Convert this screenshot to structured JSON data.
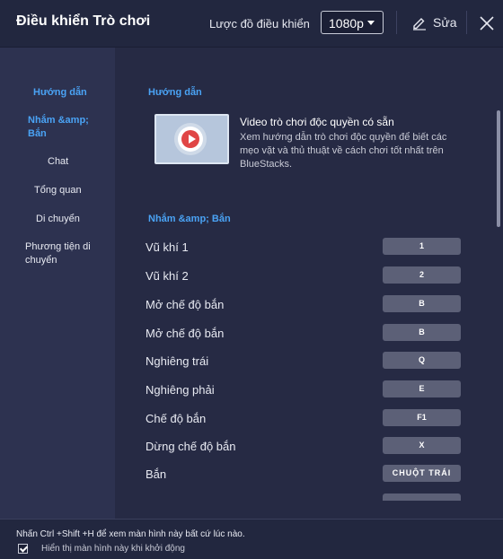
{
  "header": {
    "title": "Điều khiển Trò chơi",
    "scheme_label": "Lược đồ điều khiển",
    "resolution": "1080p",
    "edit_label": "Sửa"
  },
  "sidebar": {
    "items": [
      {
        "label": "Hướng dẫn",
        "active": true
      },
      {
        "label": "Nhắm &amp; Bắn",
        "active": true
      },
      {
        "label": "Chat",
        "active": false
      },
      {
        "label": "Tổng quan",
        "active": false
      },
      {
        "label": "Di chuyển",
        "active": false
      },
      {
        "label": "Phương tiện di chuyển",
        "active": false
      }
    ]
  },
  "guide": {
    "section_title": "Hướng dẫn",
    "video_title": "Video trò chơi độc quyền có sẵn",
    "video_desc": "Xem hướng dẫn trò chơi độc quyền để biết các mẹo vặt và thủ thuật về cách chơi tốt nhất trên BlueStacks."
  },
  "aim": {
    "section_title": "Nhắm &amp; Bắn",
    "rows": [
      {
        "label": "Vũ khí 1",
        "key": "1"
      },
      {
        "label": "Vũ khí 2",
        "key": "2"
      },
      {
        "label": "Mở chế độ bắn",
        "key": "B"
      },
      {
        "label": "Mở chế độ bắn",
        "key": "B"
      },
      {
        "label": "Nghiêng trái",
        "key": "Q"
      },
      {
        "label": "Nghiêng phải",
        "key": "E"
      },
      {
        "label": "Chế độ bắn",
        "key": "F1"
      },
      {
        "label": "Dừng chế độ bắn",
        "key": "X"
      },
      {
        "label": "Bắn",
        "key": "CHUỘT TRÁI"
      }
    ]
  },
  "footer": {
    "hint": "Nhấn Ctrl +Shift +H để xem màn hình này bất cứ lúc nào.",
    "show_on_start": "Hiển thị màn hình này khi khởi động",
    "show_on_start_checked": true
  },
  "colors": {
    "accent": "#4aa3f5",
    "background": "#262a44",
    "sidebar": "#2d3250",
    "key_bg": "#5c6077"
  }
}
